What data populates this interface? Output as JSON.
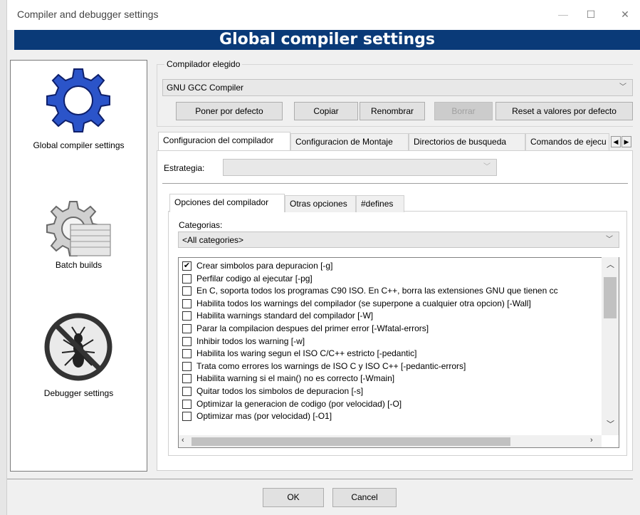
{
  "window": {
    "title": "Compiler and debugger settings",
    "minimize": "—",
    "maximize": "☐",
    "close": "✕"
  },
  "banner": {
    "title": "Global compiler settings"
  },
  "sidebar": {
    "items": [
      {
        "label": "Global compiler settings",
        "icon": "gear-icon"
      },
      {
        "label": "Batch builds",
        "icon": "gear-stack-icon"
      },
      {
        "label": "Debugger settings",
        "icon": "no-bug-icon"
      }
    ]
  },
  "compiler": {
    "group_label": "Compilador elegido",
    "selected": "GNU GCC Compiler",
    "buttons": {
      "default": "Poner por defecto",
      "copy": "Copiar",
      "rename": "Renombrar",
      "delete": "Borrar",
      "reset": "Reset a valores por defecto"
    }
  },
  "tabs": [
    "Configuracion del compilador",
    "Configuracion de Montaje",
    "Directorios de busqueda",
    "Comandos de ejecu"
  ],
  "strategy": {
    "label": "Estrategia:",
    "value": ""
  },
  "inner_tabs": [
    "Opciones del compilador",
    "Otras opciones",
    "#defines"
  ],
  "categories": {
    "label": "Categorias:",
    "selected": "<All categories>"
  },
  "options": [
    {
      "text": "Crear simbolos para depuracion  [-g]",
      "checked": true
    },
    {
      "text": "Perfilar codigo al ejecutar  [-pg]",
      "checked": false
    },
    {
      "text": "En C, soporta todos los programas C90 ISO. En C++, borra las extensiones GNU que tienen cc",
      "checked": false
    },
    {
      "text": "Habilita todos los warnings del compilador  (se superpone a cualquier otra opcion)  [-Wall]",
      "checked": false
    },
    {
      "text": "Habilita warnings standard del compilador  [-W]",
      "checked": false
    },
    {
      "text": "Parar la compilacion despues del primer error  [-Wfatal-errors]",
      "checked": false
    },
    {
      "text": "Inhibir todos los warning  [-w]",
      "checked": false
    },
    {
      "text": "Habilita los waring segun el ISO C/C++ estricto  [-pedantic]",
      "checked": false
    },
    {
      "text": "Trata como errores los warnings de ISO C y ISO C++  [-pedantic-errors]",
      "checked": false
    },
    {
      "text": "Habilita warning si el main() no es correcto  [-Wmain]",
      "checked": false
    },
    {
      "text": "Quitar todos los simbolos de depuracion  [-s]",
      "checked": false
    },
    {
      "text": "Optimizar la generacion de codigo  (por velocidad)  [-O]",
      "checked": false
    },
    {
      "text": "Optimizar mas (por velocidad)  [-O1]",
      "checked": false
    }
  ],
  "footer": {
    "ok": "OK",
    "cancel": "Cancel"
  }
}
